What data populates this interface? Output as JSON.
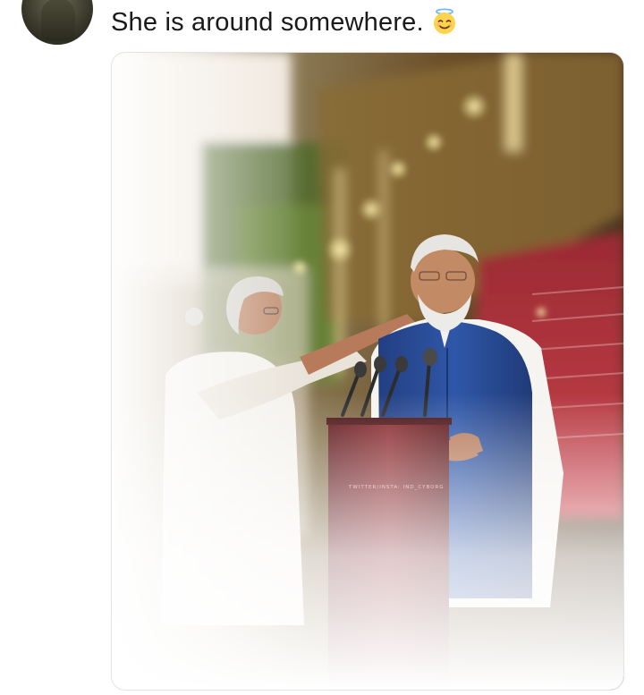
{
  "post": {
    "text": "She is around somewhere.",
    "emoji_icon": "smiling-face-with-halo",
    "watermark": "TWITTER/INSTA: IND_CYBORG"
  },
  "colors": {
    "text": "#1a1a1a",
    "card_border": "#e3e3e3",
    "vest_blue": "#2a4f9c",
    "podium": "#7a1f25",
    "carpet": "#b8323a"
  }
}
